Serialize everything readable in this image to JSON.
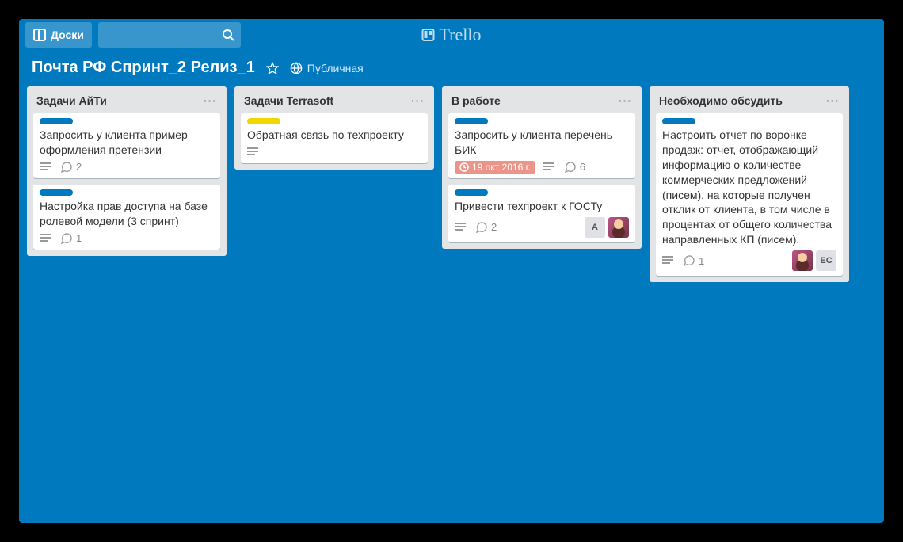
{
  "header": {
    "boards_btn": "Доски",
    "logo_text": "Trello"
  },
  "board_meta": {
    "name": "Почта РФ Спринт_2 Релиз_1",
    "visibility": "Публичная"
  },
  "label_colors": {
    "blue": "#0079BF",
    "yellow": "#F2D600"
  },
  "lists": [
    {
      "name": "Задачи АйТи",
      "cards": [
        {
          "labels": [
            "blue"
          ],
          "title": "Запросить у клиента пример оформления претензии",
          "has_description": true,
          "comments": 2,
          "due": null,
          "members": []
        },
        {
          "labels": [
            "blue"
          ],
          "title": "Настройка прав доступа на базе ролевой модели (3 спринт)",
          "has_description": true,
          "comments": 1,
          "due": null,
          "members": []
        }
      ]
    },
    {
      "name": "Задачи Terrasoft",
      "cards": [
        {
          "labels": [
            "yellow"
          ],
          "title": "Обратная связь по техпроекту",
          "has_description": true,
          "comments": 0,
          "due": null,
          "members": []
        }
      ]
    },
    {
      "name": "В работе",
      "cards": [
        {
          "labels": [
            "blue"
          ],
          "title": "Запросить у клиента перечень БИК",
          "has_description": true,
          "comments": 6,
          "due": "19 окт 2016 г.",
          "members": []
        },
        {
          "labels": [
            "blue"
          ],
          "title": "Привести техпроект к ГОСТу",
          "has_description": true,
          "comments": 2,
          "due": null,
          "members": [
            {
              "type": "initials",
              "text": "А"
            },
            {
              "type": "avatar",
              "text": ""
            }
          ]
        }
      ]
    },
    {
      "name": "Необходимо обсудить",
      "cards": [
        {
          "labels": [
            "blue"
          ],
          "title": "Настроить отчет по воронке продаж: отчет, отображающий информацию о количестве коммерческих предложений (писем), на которые получен отклик от клиента, в том числе в процентах от общего количества направленных КП (писем).",
          "has_description": true,
          "comments": 1,
          "due": null,
          "members": [
            {
              "type": "avatar",
              "text": ""
            },
            {
              "type": "initials",
              "text": "ЕС"
            }
          ]
        }
      ]
    }
  ]
}
